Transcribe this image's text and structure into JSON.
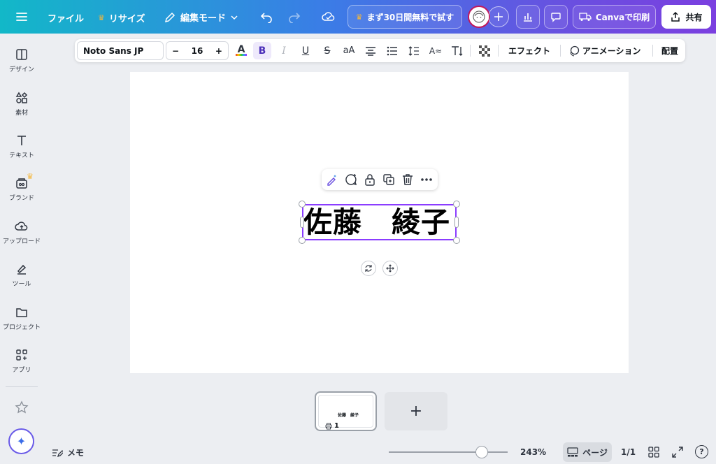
{
  "topbar": {
    "file_label": "ファイル",
    "resize_label": "リサイズ",
    "edit_mode_label": "編集モード",
    "trial_label": "まず30日間無料で試す",
    "print_label": "Canvaで印刷",
    "share_label": "共有"
  },
  "sidebar": {
    "items": [
      {
        "label": "デザイン",
        "icon": "design-icon"
      },
      {
        "label": "素材",
        "icon": "elements-icon"
      },
      {
        "label": "テキスト",
        "icon": "text-icon"
      },
      {
        "label": "ブランド",
        "icon": "brand-icon"
      },
      {
        "label": "アップロード",
        "icon": "upload-icon"
      },
      {
        "label": "ツール",
        "icon": "tools-icon"
      },
      {
        "label": "プロジェクト",
        "icon": "folder-icon"
      },
      {
        "label": "アプリ",
        "icon": "apps-icon"
      }
    ]
  },
  "format_toolbar": {
    "font_name": "Noto Sans JP",
    "font_size": "16",
    "minus": "−",
    "plus": "+",
    "effects_label": "エフェクト",
    "animation_label": "アニメーション",
    "position_label": "配置"
  },
  "canvas": {
    "text": "佐藤　綾子"
  },
  "thumbnails": {
    "page_number": "1",
    "thumb_text": "佐藤　綾子",
    "add_symbol": "+"
  },
  "bottom": {
    "notes_label": "メモ",
    "zoom_value": 0.78,
    "zoom_label": "243%",
    "pages_label": "ページ",
    "page_count": "1/1",
    "help_symbol": "?"
  },
  "colors": {
    "accent_purple": "#8b3dff",
    "crown": "#f5b73b"
  }
}
